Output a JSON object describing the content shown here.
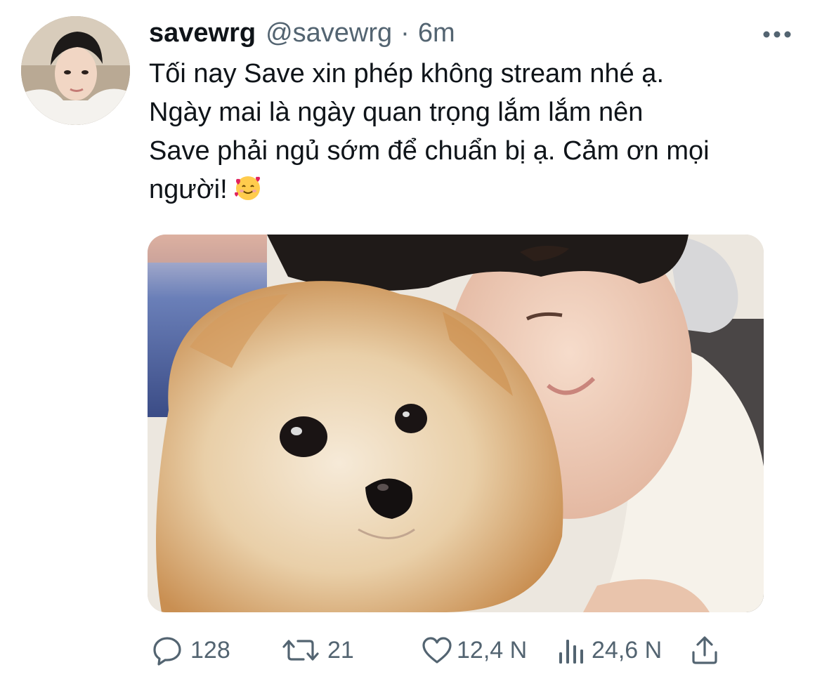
{
  "tweet": {
    "display_name": "savewrg",
    "handle": "@savewrg",
    "separator": "·",
    "time": "6m",
    "text": "Tối nay Save xin phép không stream nhé ạ.\nNgày mai là ngày quan trọng lắm lắm nên\nSave phải ngủ sớm để chuẩn bị ạ. Cảm ơn mọi\nngười!",
    "emoji_icon": "smiling-face-with-hearts-icon"
  },
  "actions": {
    "replies": "128",
    "retweets": "21",
    "likes": "12,4 N",
    "views": "24,6 N"
  },
  "colors": {
    "text": "#0f1419",
    "secondary": "#536471",
    "background": "#ffffff"
  }
}
